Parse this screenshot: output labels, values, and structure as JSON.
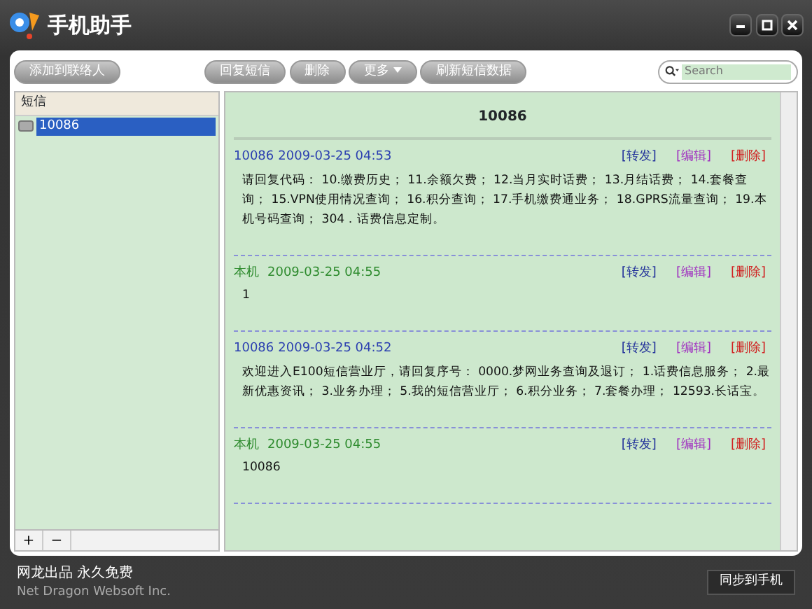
{
  "window": {
    "title": "手机助手"
  },
  "toolbar": {
    "left_buttons": [
      "添加到联络人"
    ],
    "buttons": [
      {
        "label": "回复短信",
        "dropdown": false
      },
      {
        "label": "删除",
        "dropdown": false
      },
      {
        "label": "更多",
        "dropdown": true
      },
      {
        "label": "刷新短信数据",
        "dropdown": false
      }
    ],
    "search": {
      "placeholder": "Search"
    }
  },
  "sidebar": {
    "header": "短信",
    "items": [
      {
        "label": "10086",
        "selected": true
      }
    ],
    "footer_buttons": [
      "+",
      "−"
    ]
  },
  "conversation": {
    "title": "10086",
    "messages": [
      {
        "kind": "incoming",
        "sender": "10086",
        "time": "2009-03-25 04:53",
        "body": "请回复代码： 10.缴费历史； 11.余额欠费； 12.当月实时话费； 13.月结话费； 14.套餐查询； 15.VPN使用情况查询； 16.积分查询； 17.手机缴费通业务； 18.GPRS流量查询； 19.本机号码查询； 304．话费信息定制。",
        "actions": [
          "[转发]",
          "[编辑]",
          "[删除]"
        ]
      },
      {
        "kind": "outgoing",
        "sender": "本机",
        "time": "2009-03-25 04:55",
        "body": "1",
        "actions": [
          "[转发]",
          "[编辑]",
          "[删除]"
        ]
      },
      {
        "kind": "incoming",
        "sender": "10086",
        "time": "2009-03-25 04:52",
        "body": "欢迎进入E100短信营业厅，请回复序号： 0000.梦网业务查询及退订； 1.话费信息服务； 2.最新优惠资讯； 3.业务办理； 5.我的短信营业厅； 6.积分业务； 7.套餐办理； 12593.长话宝。",
        "actions": [
          "[转发]",
          "[编辑]",
          "[删除]"
        ]
      },
      {
        "kind": "outgoing",
        "sender": "本机",
        "time": "2009-03-25 04:55",
        "body": "10086",
        "actions": [
          "[转发]",
          "[编辑]",
          "[删除]"
        ]
      }
    ]
  },
  "footer": {
    "brand": "网龙出品 永久免费",
    "company": "Net Dragon Websoft Inc.",
    "sync_button": "同步到手机"
  }
}
